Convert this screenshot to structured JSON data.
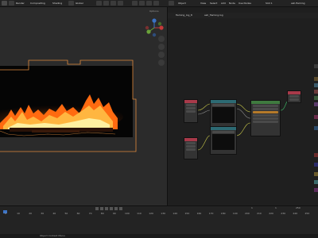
{
  "topbar": {
    "items": [
      "Render",
      "Compositing",
      "Shading",
      "Animation",
      "Scripting",
      "Layout"
    ],
    "file_title": "Blender* [C:/...]",
    "workspace_tabs": [
      "Object Mode",
      "View",
      "Select",
      "Add",
      "Node",
      "Use Nodes"
    ],
    "view_layer": "View Layer",
    "scene": "Scene"
  },
  "viewport": {
    "header_items": [
      "Render",
      "Object",
      "Global",
      "Options"
    ],
    "options_label": "Options"
  },
  "node_editor": {
    "header_items": [
      "Object",
      "View",
      "Select",
      "Add",
      "Node",
      "Use Nodes"
    ],
    "slot": "Slot 1",
    "material": "ash.flaming",
    "breadcrumbs": [
      "flaming_log_8",
      "ash_flaming.log"
    ]
  },
  "timeline": {
    "ticks": [
      "0",
      "10",
      "20",
      "30",
      "40",
      "50",
      "60",
      "70",
      "80",
      "90",
      "100",
      "110",
      "120",
      "130",
      "140",
      "150",
      "160",
      "170",
      "180",
      "190",
      "200",
      "210",
      "220",
      "230",
      "240",
      "250"
    ],
    "frame_current": "1",
    "frame_start": "1",
    "frame_end": "250"
  },
  "status": {
    "text": "Object Context Menu"
  },
  "colors": {
    "fire": "#ff7a1a",
    "outline": "#e08a3c",
    "node_green": "#3f7a3f",
    "node_red": "#a83a4a",
    "node_teal": "#2d6a73"
  }
}
